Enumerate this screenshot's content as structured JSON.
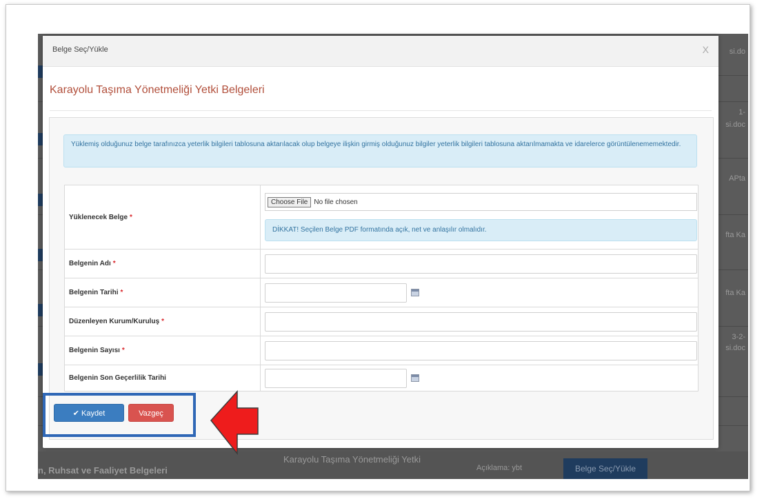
{
  "background": {
    "right_texts": [
      "si.do",
      "1-",
      "si.doc",
      "APta",
      "fta Ka",
      "fta Ka",
      "3-2-",
      "si.doc"
    ],
    "bottom_left_text": "n, Ruhsat ve Faaliyet Belgeleri",
    "bottom_mid_text": "Karayolu Taşıma Yönetmeliği Yetki",
    "bottom_desc_text": "Açıklama: ybt",
    "bottom_button": "Belge Seç/Yükle"
  },
  "modal": {
    "title": "Belge Seç/Yükle",
    "close": "X",
    "section_title": "Karayolu Taşıma Yönetmeliği Yetki Belgeleri",
    "info": "Yüklemiş olduğunuz belge tarafınızca yeterlik bilgileri tablosuna aktarılacak olup belgeye ilişkin girmiş olduğunuz bilgiler yeterlik bilgileri tablosuna aktarılmamakta ve idarelerce görüntülenememektedir."
  },
  "form": {
    "upload_label": "Yüklenecek Belge",
    "file_button": "Choose File",
    "file_status": "No file chosen",
    "warning": "DİKKAT! Seçilen Belge PDF formatında açık, net ve anlaşılır olmalıdır.",
    "name_label": "Belgenin Adı",
    "date_label": "Belgenin Tarihi",
    "issuer_label": "Düzenleyen Kurum/Kuruluş",
    "number_label": "Belgenin Sayısı",
    "expiry_label": "Belgenin Son Geçerlilik Tarihi",
    "required_mark": "*"
  },
  "buttons": {
    "save": "Kaydet",
    "save_icon": "check-icon",
    "cancel": "Vazgeç"
  },
  "annotation": {
    "highlight_color": "#2f67b6",
    "arrow_color": "#ee1c1c"
  }
}
